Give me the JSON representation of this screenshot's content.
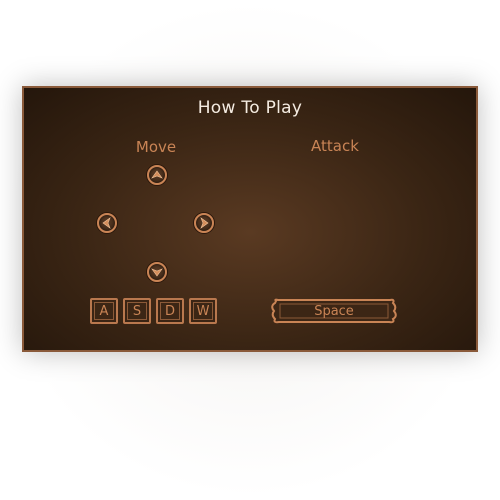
{
  "panel": {
    "title": "How To Play"
  },
  "move": {
    "label": "Move",
    "arrows": [
      "arrow-up-icon",
      "arrow-left-icon",
      "arrow-right-icon",
      "arrow-down-icon"
    ],
    "keys": [
      "A",
      "S",
      "D",
      "W"
    ]
  },
  "attack": {
    "label": "Attack",
    "key": "Space"
  },
  "colors": {
    "panel_bg": "#3a2514",
    "panel_border": "#8a5a3a",
    "title_text": "#f5ece2",
    "accent": "#c98455"
  }
}
